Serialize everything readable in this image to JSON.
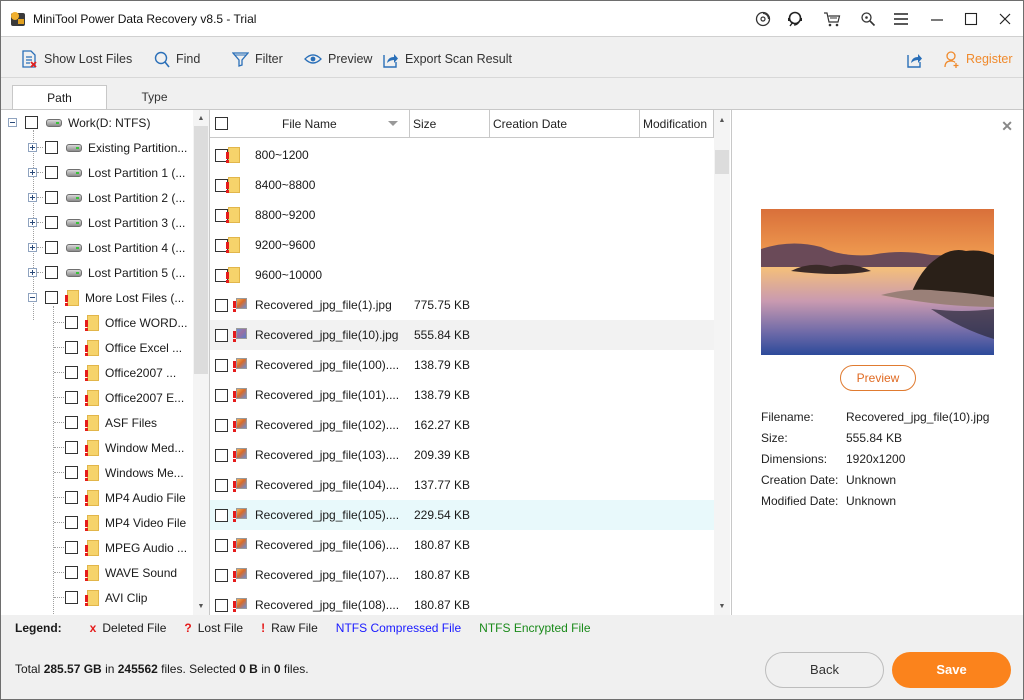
{
  "window": {
    "title": "MiniTool Power Data Recovery v8.5 - Trial",
    "controls": [
      "disc-icon",
      "support-icon",
      "cart-icon",
      "key-search-icon",
      "menu-icon",
      "minimize-icon",
      "maximize-icon",
      "close-icon"
    ]
  },
  "toolbar": {
    "show_lost_files": "Show Lost Files",
    "find": "Find",
    "filter": "Filter",
    "preview": "Preview",
    "export_scan_result": "Export Scan Result",
    "register": "Register"
  },
  "tabs": [
    {
      "label": "Path",
      "active": true
    },
    {
      "label": "Type",
      "active": false
    }
  ],
  "tree": {
    "root": {
      "label": "Work(D: NTFS)",
      "expanded": true
    },
    "partitions": [
      {
        "label": "Existing Partition..."
      },
      {
        "label": "Lost Partition 1 (..."
      },
      {
        "label": "Lost Partition 2 (..."
      },
      {
        "label": "Lost Partition 3 (..."
      },
      {
        "label": "Lost Partition 4 (..."
      },
      {
        "label": "Lost Partition 5 (..."
      }
    ],
    "more_lost_files": {
      "label": "More Lost Files (...",
      "expanded": true
    },
    "children": [
      {
        "label": "Office WORD..."
      },
      {
        "label": "Office Excel ..."
      },
      {
        "label": "Office2007 ..."
      },
      {
        "label": "Office2007 E..."
      },
      {
        "label": "ASF Files"
      },
      {
        "label": "Window Med..."
      },
      {
        "label": "Windows Me..."
      },
      {
        "label": "MP4 Audio File"
      },
      {
        "label": "MP4 Video File"
      },
      {
        "label": "MPEG Audio ..."
      },
      {
        "label": "WAVE Sound"
      },
      {
        "label": "AVI Clip"
      }
    ]
  },
  "file_list": {
    "columns": [
      "File Name",
      "Size",
      "Creation Date",
      "Modification"
    ],
    "rows": [
      {
        "name": "800~1200",
        "size": "",
        "type": "folder"
      },
      {
        "name": "8400~8800",
        "size": "",
        "type": "folder"
      },
      {
        "name": "8800~9200",
        "size": "",
        "type": "folder"
      },
      {
        "name": "9200~9600",
        "size": "",
        "type": "folder"
      },
      {
        "name": "9600~10000",
        "size": "",
        "type": "folder"
      },
      {
        "name": "Recovered_jpg_file(1).jpg",
        "size": "775.75 KB",
        "type": "image"
      },
      {
        "name": "Recovered_jpg_file(10).jpg",
        "size": "555.84 KB",
        "type": "image",
        "selected": true
      },
      {
        "name": "Recovered_jpg_file(100)....",
        "size": "138.79 KB",
        "type": "image"
      },
      {
        "name": "Recovered_jpg_file(101)....",
        "size": "138.79 KB",
        "type": "image"
      },
      {
        "name": "Recovered_jpg_file(102)....",
        "size": "162.27 KB",
        "type": "image"
      },
      {
        "name": "Recovered_jpg_file(103)....",
        "size": "209.39 KB",
        "type": "image"
      },
      {
        "name": "Recovered_jpg_file(104)....",
        "size": "137.77 KB",
        "type": "image"
      },
      {
        "name": "Recovered_jpg_file(105)....",
        "size": "229.54 KB",
        "type": "image",
        "hover": true
      },
      {
        "name": "Recovered_jpg_file(106)....",
        "size": "180.87 KB",
        "type": "image"
      },
      {
        "name": "Recovered_jpg_file(107)....",
        "size": "180.87 KB",
        "type": "image"
      },
      {
        "name": "Recovered_jpg_file(108)....",
        "size": "180.87 KB",
        "type": "image"
      }
    ]
  },
  "preview": {
    "button": "Preview",
    "info": [
      {
        "label": "Filename:",
        "value": "Recovered_jpg_file(10).jpg"
      },
      {
        "label": "Size:",
        "value": "555.84 KB"
      },
      {
        "label": "Dimensions:",
        "value": "1920x1200"
      },
      {
        "label": "Creation Date:",
        "value": "Unknown"
      },
      {
        "label": "Modified Date:",
        "value": "Unknown"
      }
    ]
  },
  "legend": {
    "title": "Legend:",
    "items": [
      {
        "mark": "x",
        "label": "Deleted File"
      },
      {
        "mark": "?",
        "label": "Lost File"
      },
      {
        "mark": "!",
        "label": "Raw File"
      },
      {
        "mark": "",
        "label": "NTFS Compressed File",
        "color": "#1a1aff"
      },
      {
        "mark": "",
        "label": "NTFS Encrypted File",
        "color": "#1a8a1a"
      }
    ]
  },
  "status": {
    "total_prefix": "Total ",
    "total_size": "285.57 GB",
    "in1": " in ",
    "total_files": "245562",
    "files1": " files.  Selected ",
    "selected_size": "0 B",
    "in2": " in ",
    "selected_files": "0",
    "files2": " files."
  },
  "footer": {
    "back": "Back",
    "save": "Save"
  },
  "colors": {
    "accent_orange": "#fb831c",
    "register_orange": "#f08a2c",
    "raw_red": "#e51b1b"
  }
}
